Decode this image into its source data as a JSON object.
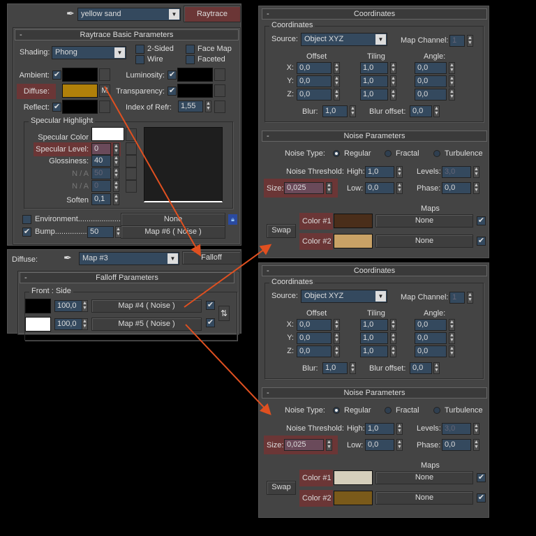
{
  "raytrace": {
    "material_name": "yellow sand",
    "type_button": "Raytrace",
    "rollout_title": "Raytrace Basic Parameters",
    "shading_label": "Shading:",
    "shading_value": "Phong",
    "two_sided": "2-Sided",
    "wire": "Wire",
    "face_map": "Face Map",
    "faceted": "Faceted",
    "ambient": "Ambient:",
    "diffuse": "Diffuse:",
    "diffuse_map_btn": "M",
    "reflect": "Reflect:",
    "luminosity": "Luminosity:",
    "transparency": "Transparency:",
    "ior_label": "Index of Refr:",
    "ior_value": "1,55",
    "spec_group": "Specular Highlight",
    "spec_color": "Specular Color",
    "spec_level": "Specular Level:",
    "spec_level_value": "0",
    "glossiness": "Glossiness:",
    "glossiness_value": "40",
    "na1": "N / A",
    "na1_value": "50",
    "na2": "N / A",
    "na2_value": "0",
    "soften": "Soften",
    "soften_value": "0,1",
    "environment": "Environment.....................",
    "environment_map": "None",
    "bump": "Bump...............",
    "bump_value": "50",
    "bump_map": "Map #6  ( Noise )",
    "colors": {
      "diffuse": "#b0800a",
      "ambient": "#000000",
      "reflect": "#000000",
      "luminosity": "#000000",
      "transparency": "#000000",
      "spec": "#ffffff"
    }
  },
  "falloff": {
    "slot_label": "Diffuse:",
    "map_name": "Map #3",
    "type_button": "Falloff",
    "rollout_title": "Falloff Parameters",
    "group": "Front : Side",
    "rows": [
      {
        "color": "#000000",
        "value": "100,0",
        "map": "Map #4  ( Noise )",
        "checked": true
      },
      {
        "color": "#ffffff",
        "value": "100,0",
        "map": "Map #5  ( Noise )",
        "checked": true
      }
    ]
  },
  "noise_panels": [
    {
      "coords_title": "Coordinates",
      "coords_group": "Coordinates",
      "source_label": "Source:",
      "source": "Object XYZ",
      "map_channel_label": "Map Channel:",
      "map_channel": "1",
      "offset": "Offset",
      "tiling": "Tiling",
      "angle": "Angle:",
      "axes": [
        "X:",
        "Y:",
        "Z:"
      ],
      "offset_values": [
        "0,0",
        "0,0",
        "0,0"
      ],
      "tiling_values": [
        "1,0",
        "1,0",
        "1,0"
      ],
      "angle_values": [
        "0,0",
        "0,0",
        "0,0"
      ],
      "blur_label": "Blur:",
      "blur": "1,0",
      "blur_offset_label": "Blur offset:",
      "blur_offset": "0,0",
      "noise_title": "Noise Parameters",
      "noise_type_label": "Noise Type:",
      "types": [
        "Regular",
        "Fractal",
        "Turbulence"
      ],
      "selected_type": "Regular",
      "threshold_label": "Noise Threshold:",
      "high_label": "High:",
      "high": "1,0",
      "levels_label": "Levels:",
      "levels": "3,0",
      "size_label": "Size:",
      "size": "0,025",
      "low_label": "Low:",
      "low": "0,0",
      "phase_label": "Phase:",
      "phase": "0,0",
      "maps_label": "Maps",
      "swap": "Swap",
      "color1_label": "Color #1",
      "color2_label": "Color #2",
      "color1": "#4a2e1a",
      "color2": "#c9a266",
      "map1": "None",
      "map2": "None"
    },
    {
      "coords_title": "Coordinates",
      "coords_group": "Coordinates",
      "source_label": "Source:",
      "source": "Object XYZ",
      "map_channel_label": "Map Channel:",
      "map_channel": "1",
      "offset": "Offset",
      "tiling": "Tiling",
      "angle": "Angle:",
      "axes": [
        "X:",
        "Y:",
        "Z:"
      ],
      "offset_values": [
        "0,0",
        "0,0",
        "0,0"
      ],
      "tiling_values": [
        "1,0",
        "1,0",
        "1,0"
      ],
      "angle_values": [
        "0,0",
        "0,0",
        "0,0"
      ],
      "blur_label": "Blur:",
      "blur": "1,0",
      "blur_offset_label": "Blur offset:",
      "blur_offset": "0,0",
      "noise_title": "Noise Parameters",
      "noise_type_label": "Noise Type:",
      "types": [
        "Regular",
        "Fractal",
        "Turbulence"
      ],
      "selected_type": "Regular",
      "threshold_label": "Noise Threshold:",
      "high_label": "High:",
      "high": "1,0",
      "levels_label": "Levels:",
      "levels": "3,0",
      "size_label": "Size:",
      "size": "0,025",
      "low_label": "Low:",
      "low": "0,0",
      "phase_label": "Phase:",
      "phase": "0,0",
      "maps_label": "Maps",
      "swap": "Swap",
      "color1_label": "Color #1",
      "color2_label": "Color #2",
      "color1": "#d6cfbc",
      "color2": "#7a5a1a",
      "map1": "None",
      "map2": "None"
    }
  ],
  "accent": {
    "highlight": "#6b3636",
    "arrow": "#e05020"
  }
}
